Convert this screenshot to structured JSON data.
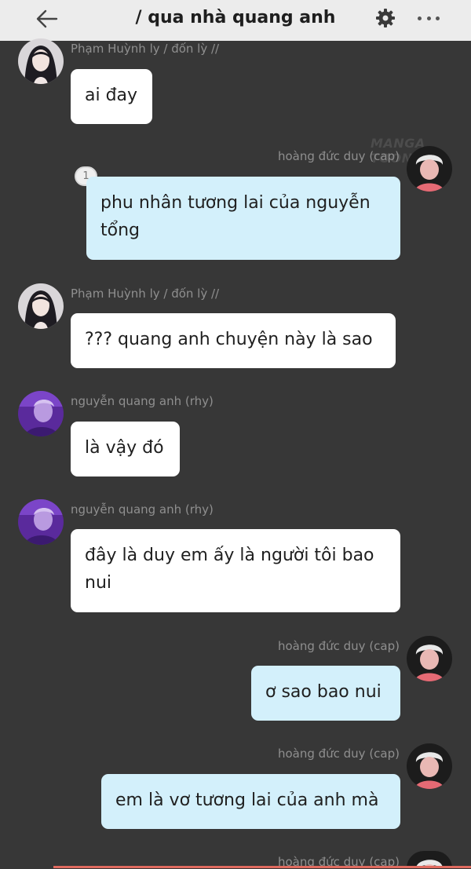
{
  "header": {
    "title": "/ qua nhà quang anh",
    "back_icon": "arrow-left-icon",
    "settings_icon": "gear-icon",
    "more_icon": "more-dots-icon"
  },
  "watermark": "MANGA TOON",
  "messages": [
    {
      "sender": "Phạm Huỳnh ly / đốn lỳ //",
      "text": "ai đay",
      "direction": "in"
    },
    {
      "sender": "hoàng đức duy (cap)",
      "text": "phu nhân tương lai của nguyễn tổng",
      "reply_count": "1",
      "direction": "out"
    },
    {
      "sender": "Phạm Huỳnh ly / đốn lỳ //",
      "text": "??? quang anh chuyện này là sao",
      "direction": "in"
    },
    {
      "sender": "nguyễn quang anh (rhy)",
      "text": "là vậy đó",
      "direction": "in"
    },
    {
      "sender": "nguyễn quang anh (rhy)",
      "text": "đây là duy em ấy là người tôi bao nui",
      "direction": "in"
    },
    {
      "sender": "hoàng đức duy (cap)",
      "text": "ơ sao bao nui",
      "direction": "out"
    },
    {
      "sender": "hoàng đức duy (cap)",
      "text": "em là vơ tương lai của anh mà",
      "direction": "out"
    },
    {
      "sender": "hoàng đức duy (cap)",
      "direction": "out"
    }
  ],
  "colors": {
    "background": "#373737",
    "topbar": "#ececec",
    "incoming_bubble": "#ffffff",
    "outgoing_bubble": "#d3f0fb",
    "sender_text": "#8f8f8f"
  }
}
